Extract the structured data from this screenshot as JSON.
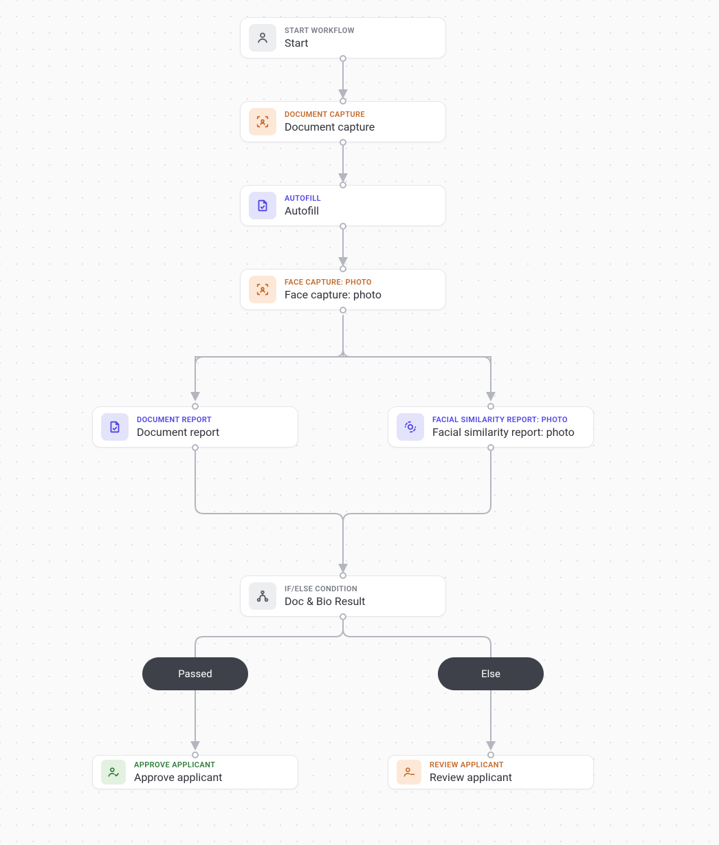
{
  "nodes": {
    "start": {
      "type": "START WORKFLOW",
      "title": "Start"
    },
    "doccap": {
      "type": "DOCUMENT CAPTURE",
      "title": "Document capture"
    },
    "autofill": {
      "type": "AUTOFILL",
      "title": "Autofill"
    },
    "facecap": {
      "type": "FACE CAPTURE: PHOTO",
      "title": "Face capture: photo"
    },
    "docreport": {
      "type": "DOCUMENT REPORT",
      "title": "Document report"
    },
    "facereport": {
      "type": "FACIAL SIMILARITY REPORT: PHOTO",
      "title": "Facial similarity report: photo"
    },
    "condition": {
      "type": "IF/ELSE CONDITION",
      "title": "Doc & Bio Result"
    },
    "approve": {
      "type": "APPROVE APPLICANT",
      "title": "Approve applicant"
    },
    "review": {
      "type": "REVIEW APPLICANT",
      "title": "Review applicant"
    }
  },
  "branches": {
    "passed": "Passed",
    "else": "Else"
  },
  "colors": {
    "gray": "#787b86",
    "orange": "#c46a2a",
    "indigo": "#4f46e5",
    "green": "#2e7d3a"
  }
}
